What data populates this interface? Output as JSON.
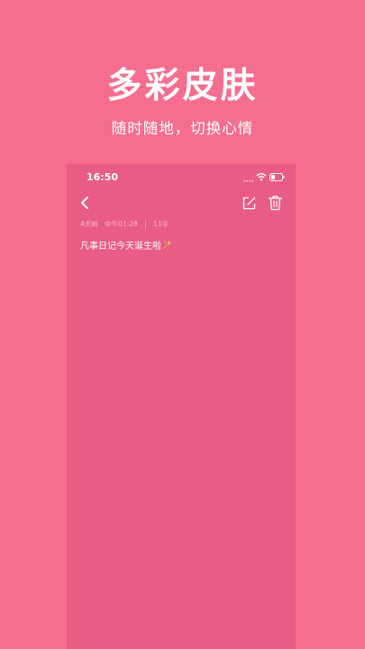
{
  "hero": {
    "title": "多彩皮肤",
    "subtitle": "随时随地，切换心情"
  },
  "phone": {
    "status_bar": {
      "time": "16:50",
      "icons": [
        "signal-icon",
        "wifi-icon",
        "battery-icon"
      ]
    },
    "toolbar": {
      "back_icon": "chevron-left-icon",
      "edit_icon": "edit-icon",
      "delete_icon": "trash-icon"
    },
    "note": {
      "date": "4天前",
      "time": "中午01:28",
      "separator": "|",
      "word_count": "11字",
      "body": "凡事日记今天诞生啦",
      "sparkle_icon": "sparkle-emoji-icon"
    }
  },
  "colors": {
    "background": "#F56E8F",
    "phone_background": "#E95C85",
    "text": "#FFFFFF",
    "meta_text": "#F7B6C8"
  }
}
